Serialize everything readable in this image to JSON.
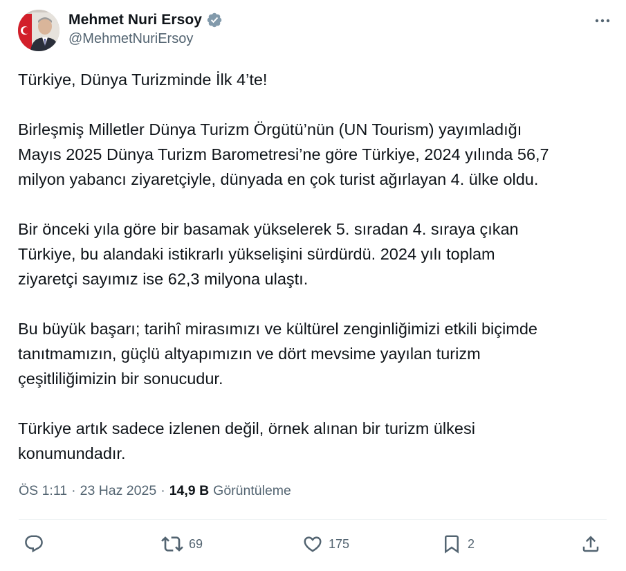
{
  "author": {
    "display_name": "Mehmet Nuri Ersoy",
    "handle": "@MehmetNuriErsoy",
    "verified": true
  },
  "tweet": {
    "paragraphs": [
      [
        "Türkiye, Dünya Turizminde İlk 4’te!"
      ],
      [
        "Birleşmiş Milletler Dünya Turizm Örgütü’nün (UN Tourism) yayımladığı",
        "Mayıs 2025 Dünya Turizm Barometresi’ne göre Türkiye, 2024 yılında 56,7",
        "milyon yabancı ziyaretçiyle, dünyada en çok turist ağırlayan 4. ülke oldu."
      ],
      [
        "Bir önceki yıla göre bir basamak yükselerek 5. sıradan 4. sıraya çıkan",
        "Türkiye, bu alandaki istikrarlı yükselişini sürdürdü. 2024 yılı toplam",
        "ziyaretçi sayımız ise 62,3 milyona ulaştı."
      ],
      [
        "Bu büyük başarı; tarihî mirasımızı ve kültürel zenginliğimizi etkili biçimde",
        "tanıtmamızın, güçlü altyapımızın ve dört mevsime yayılan turizm",
        "çeşitliliğimizin bir sonucudur."
      ],
      [
        "Türkiye artık sadece izlenen değil, örnek alınan bir turizm ülkesi",
        "konumundadır."
      ]
    ]
  },
  "meta": {
    "time": "ÖS 1:11",
    "separator": "·",
    "date": "23 Haz 2025",
    "views_count": "14,9 B",
    "views_label": "Görüntüleme"
  },
  "actions": {
    "reply_count": "",
    "retweet_count": "69",
    "like_count": "175",
    "bookmark_count": "2"
  },
  "colors": {
    "text": "#0f1419",
    "secondary": "#536471",
    "verified": "#829aab",
    "divider": "#eff3f4"
  },
  "icons": [
    "verified-badge-icon",
    "more-icon",
    "reply-icon",
    "retweet-icon",
    "like-icon",
    "bookmark-icon",
    "share-icon"
  ]
}
